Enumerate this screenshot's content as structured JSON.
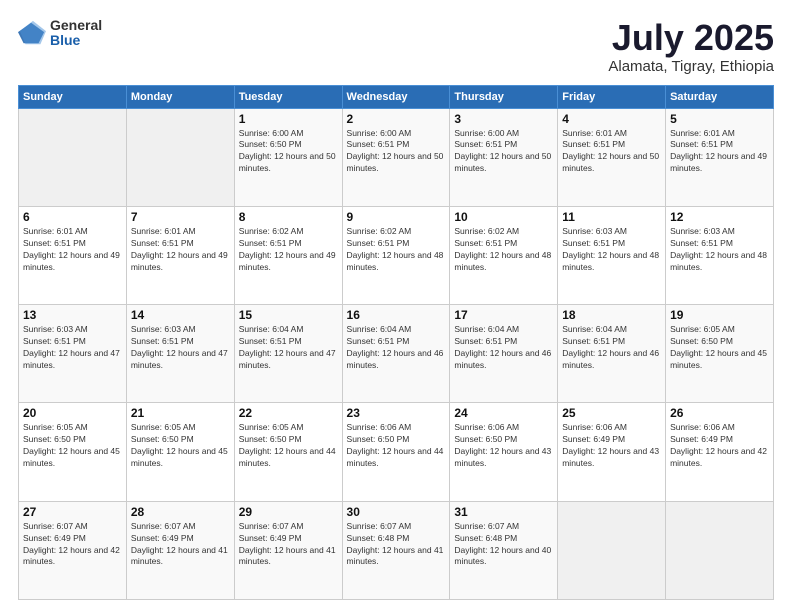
{
  "logo": {
    "general": "General",
    "blue": "Blue"
  },
  "header": {
    "month": "July 2025",
    "location": "Alamata, Tigray, Ethiopia"
  },
  "weekdays": [
    "Sunday",
    "Monday",
    "Tuesday",
    "Wednesday",
    "Thursday",
    "Friday",
    "Saturday"
  ],
  "weeks": [
    [
      {
        "day": "",
        "sunrise": "",
        "sunset": "",
        "daylight": ""
      },
      {
        "day": "",
        "sunrise": "",
        "sunset": "",
        "daylight": ""
      },
      {
        "day": "1",
        "sunrise": "Sunrise: 6:00 AM",
        "sunset": "Sunset: 6:50 PM",
        "daylight": "Daylight: 12 hours and 50 minutes."
      },
      {
        "day": "2",
        "sunrise": "Sunrise: 6:00 AM",
        "sunset": "Sunset: 6:51 PM",
        "daylight": "Daylight: 12 hours and 50 minutes."
      },
      {
        "day": "3",
        "sunrise": "Sunrise: 6:00 AM",
        "sunset": "Sunset: 6:51 PM",
        "daylight": "Daylight: 12 hours and 50 minutes."
      },
      {
        "day": "4",
        "sunrise": "Sunrise: 6:01 AM",
        "sunset": "Sunset: 6:51 PM",
        "daylight": "Daylight: 12 hours and 50 minutes."
      },
      {
        "day": "5",
        "sunrise": "Sunrise: 6:01 AM",
        "sunset": "Sunset: 6:51 PM",
        "daylight": "Daylight: 12 hours and 49 minutes."
      }
    ],
    [
      {
        "day": "6",
        "sunrise": "Sunrise: 6:01 AM",
        "sunset": "Sunset: 6:51 PM",
        "daylight": "Daylight: 12 hours and 49 minutes."
      },
      {
        "day": "7",
        "sunrise": "Sunrise: 6:01 AM",
        "sunset": "Sunset: 6:51 PM",
        "daylight": "Daylight: 12 hours and 49 minutes."
      },
      {
        "day": "8",
        "sunrise": "Sunrise: 6:02 AM",
        "sunset": "Sunset: 6:51 PM",
        "daylight": "Daylight: 12 hours and 49 minutes."
      },
      {
        "day": "9",
        "sunrise": "Sunrise: 6:02 AM",
        "sunset": "Sunset: 6:51 PM",
        "daylight": "Daylight: 12 hours and 48 minutes."
      },
      {
        "day": "10",
        "sunrise": "Sunrise: 6:02 AM",
        "sunset": "Sunset: 6:51 PM",
        "daylight": "Daylight: 12 hours and 48 minutes."
      },
      {
        "day": "11",
        "sunrise": "Sunrise: 6:03 AM",
        "sunset": "Sunset: 6:51 PM",
        "daylight": "Daylight: 12 hours and 48 minutes."
      },
      {
        "day": "12",
        "sunrise": "Sunrise: 6:03 AM",
        "sunset": "Sunset: 6:51 PM",
        "daylight": "Daylight: 12 hours and 48 minutes."
      }
    ],
    [
      {
        "day": "13",
        "sunrise": "Sunrise: 6:03 AM",
        "sunset": "Sunset: 6:51 PM",
        "daylight": "Daylight: 12 hours and 47 minutes."
      },
      {
        "day": "14",
        "sunrise": "Sunrise: 6:03 AM",
        "sunset": "Sunset: 6:51 PM",
        "daylight": "Daylight: 12 hours and 47 minutes."
      },
      {
        "day": "15",
        "sunrise": "Sunrise: 6:04 AM",
        "sunset": "Sunset: 6:51 PM",
        "daylight": "Daylight: 12 hours and 47 minutes."
      },
      {
        "day": "16",
        "sunrise": "Sunrise: 6:04 AM",
        "sunset": "Sunset: 6:51 PM",
        "daylight": "Daylight: 12 hours and 46 minutes."
      },
      {
        "day": "17",
        "sunrise": "Sunrise: 6:04 AM",
        "sunset": "Sunset: 6:51 PM",
        "daylight": "Daylight: 12 hours and 46 minutes."
      },
      {
        "day": "18",
        "sunrise": "Sunrise: 6:04 AM",
        "sunset": "Sunset: 6:51 PM",
        "daylight": "Daylight: 12 hours and 46 minutes."
      },
      {
        "day": "19",
        "sunrise": "Sunrise: 6:05 AM",
        "sunset": "Sunset: 6:50 PM",
        "daylight": "Daylight: 12 hours and 45 minutes."
      }
    ],
    [
      {
        "day": "20",
        "sunrise": "Sunrise: 6:05 AM",
        "sunset": "Sunset: 6:50 PM",
        "daylight": "Daylight: 12 hours and 45 minutes."
      },
      {
        "day": "21",
        "sunrise": "Sunrise: 6:05 AM",
        "sunset": "Sunset: 6:50 PM",
        "daylight": "Daylight: 12 hours and 45 minutes."
      },
      {
        "day": "22",
        "sunrise": "Sunrise: 6:05 AM",
        "sunset": "Sunset: 6:50 PM",
        "daylight": "Daylight: 12 hours and 44 minutes."
      },
      {
        "day": "23",
        "sunrise": "Sunrise: 6:06 AM",
        "sunset": "Sunset: 6:50 PM",
        "daylight": "Daylight: 12 hours and 44 minutes."
      },
      {
        "day": "24",
        "sunrise": "Sunrise: 6:06 AM",
        "sunset": "Sunset: 6:50 PM",
        "daylight": "Daylight: 12 hours and 43 minutes."
      },
      {
        "day": "25",
        "sunrise": "Sunrise: 6:06 AM",
        "sunset": "Sunset: 6:49 PM",
        "daylight": "Daylight: 12 hours and 43 minutes."
      },
      {
        "day": "26",
        "sunrise": "Sunrise: 6:06 AM",
        "sunset": "Sunset: 6:49 PM",
        "daylight": "Daylight: 12 hours and 42 minutes."
      }
    ],
    [
      {
        "day": "27",
        "sunrise": "Sunrise: 6:07 AM",
        "sunset": "Sunset: 6:49 PM",
        "daylight": "Daylight: 12 hours and 42 minutes."
      },
      {
        "day": "28",
        "sunrise": "Sunrise: 6:07 AM",
        "sunset": "Sunset: 6:49 PM",
        "daylight": "Daylight: 12 hours and 41 minutes."
      },
      {
        "day": "29",
        "sunrise": "Sunrise: 6:07 AM",
        "sunset": "Sunset: 6:49 PM",
        "daylight": "Daylight: 12 hours and 41 minutes."
      },
      {
        "day": "30",
        "sunrise": "Sunrise: 6:07 AM",
        "sunset": "Sunset: 6:48 PM",
        "daylight": "Daylight: 12 hours and 41 minutes."
      },
      {
        "day": "31",
        "sunrise": "Sunrise: 6:07 AM",
        "sunset": "Sunset: 6:48 PM",
        "daylight": "Daylight: 12 hours and 40 minutes."
      },
      {
        "day": "",
        "sunrise": "",
        "sunset": "",
        "daylight": ""
      },
      {
        "day": "",
        "sunrise": "",
        "sunset": "",
        "daylight": ""
      }
    ]
  ]
}
